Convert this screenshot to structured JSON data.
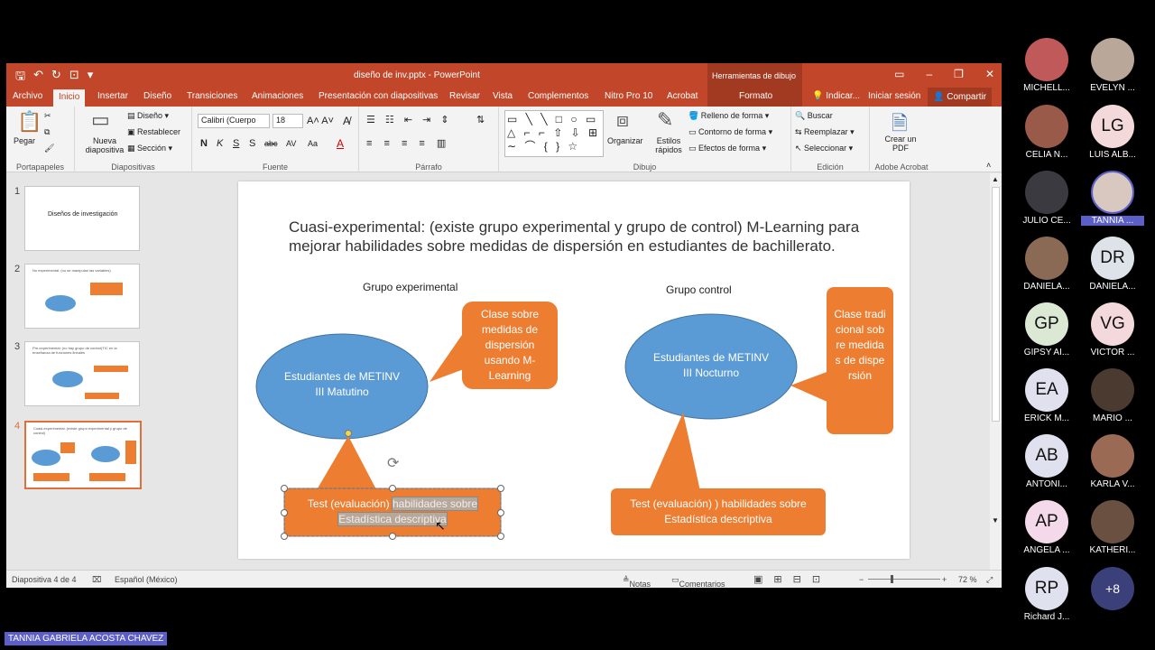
{
  "window": {
    "title": "diseño de inv.pptx - PowerPoint",
    "tools_label": "Herramientas de dibujo"
  },
  "tabs": [
    "Archivo",
    "Inicio",
    "Insertar",
    "Diseño",
    "Transiciones",
    "Animaciones",
    "Presentación con diapositivas",
    "Revisar",
    "Vista",
    "Complementos",
    "Nitro Pro 10",
    "Acrobat"
  ],
  "format_tab": "Formato",
  "tab_right": {
    "tell": "Indicar...",
    "signin": "Iniciar sesión",
    "share": "Compartir"
  },
  "ribbon": {
    "clipboard": {
      "paste": "Pegar",
      "label": "Portapapeles"
    },
    "slides": {
      "new": "Nueva diapositiva",
      "layout": "Diseño",
      "reset": "Restablecer",
      "section": "Sección",
      "label": "Diapositivas"
    },
    "font": {
      "name": "Calibri (Cuerpo",
      "size": "18",
      "label": "Fuente",
      "bold": "N",
      "italic": "K",
      "underline": "S",
      "strike": "S",
      "abc": "abc",
      "spacing": "AV",
      "case": "Aa"
    },
    "paragraph": {
      "label": "Párrafo"
    },
    "drawing": {
      "arrange": "Organizar",
      "styles": "Estilos rápidos",
      "fill": "Relleno de forma",
      "outline": "Contorno de forma",
      "effects": "Efectos de forma",
      "label": "Dibujo"
    },
    "editing": {
      "find": "Buscar",
      "replace": "Reemplazar",
      "select": "Seleccionar",
      "label": "Edición"
    },
    "acrobat": {
      "create": "Crear un PDF",
      "label": "Adobe Acrobat"
    }
  },
  "thumbnails": [
    {
      "num": "1",
      "text": "Diseños de investigación"
    },
    {
      "num": "2",
      "text": "No experimental: (no se manipulan las variables)"
    },
    {
      "num": "3",
      "text": "Pre-experimental: (no hay grupo de control)TIC en la enseñanza de funciones lineales"
    },
    {
      "num": "4",
      "text": "Cuasi-experimental: (existe grupo experimental y grupo de control)"
    }
  ],
  "slide": {
    "title": "Cuasi-experimental: (existe grupo experimental y grupo de control) M-Learning para mejorar habilidades sobre medidas de dispersión en estudiantes de bachillerato.",
    "exp_label": "Grupo experimental",
    "ctrl_label": "Grupo control",
    "exp_ellipse": "Estudiantes de METINV III Matutino",
    "ctrl_ellipse": "Estudiantes de METINV III Nocturno",
    "exp_callout": "Clase sobre medidas de dispersión usando M-Learning",
    "ctrl_callout": "Clase tradicional sobre medidas de dispersión",
    "exp_test_a": "Test (evaluación)",
    "exp_test_b": "habilidades sobre",
    "exp_test_c": "Estadística descriptiva",
    "ctrl_test": "Test (evaluación) ) habilidades sobre Estadística descriptiva"
  },
  "status": {
    "slide": "Diapositiva 4 de 4",
    "lang": "Español (México)",
    "notes": "Notas",
    "comments": "Comentarios",
    "zoom": "72 %"
  },
  "participants": [
    {
      "initials": "",
      "name": "MICHELL..."
    },
    {
      "initials": "",
      "name": "EVELYN ..."
    },
    {
      "initials": "",
      "name": "CELIA N..."
    },
    {
      "initials": "LG",
      "name": "LUIS ALB..."
    },
    {
      "initials": "",
      "name": "JULIO CE..."
    },
    {
      "initials": "",
      "name": "TANNIA ..."
    },
    {
      "initials": "",
      "name": "DANIELA..."
    },
    {
      "initials": "DR",
      "name": "DANIELA..."
    },
    {
      "initials": "GP",
      "name": "GIPSY AI..."
    },
    {
      "initials": "VG",
      "name": "VICTOR ..."
    },
    {
      "initials": "EA",
      "name": "ERICK M..."
    },
    {
      "initials": "",
      "name": "MARIO ..."
    },
    {
      "initials": "AB",
      "name": "ANTONI..."
    },
    {
      "initials": "",
      "name": "KARLA V..."
    },
    {
      "initials": "AP",
      "name": "ANGELA ..."
    },
    {
      "initials": "",
      "name": "KATHERI..."
    },
    {
      "initials": "RP",
      "name": "Richard J..."
    },
    {
      "initials": "+8",
      "name": ""
    }
  ],
  "speaker": "TANNIA GABRIELA ACOSTA CHAVEZ",
  "colors": {
    "ppt_red": "#c1462a",
    "orange": "#ed7d31",
    "blue": "#5b9bd5",
    "teams_purple": "#5b5fc7"
  }
}
